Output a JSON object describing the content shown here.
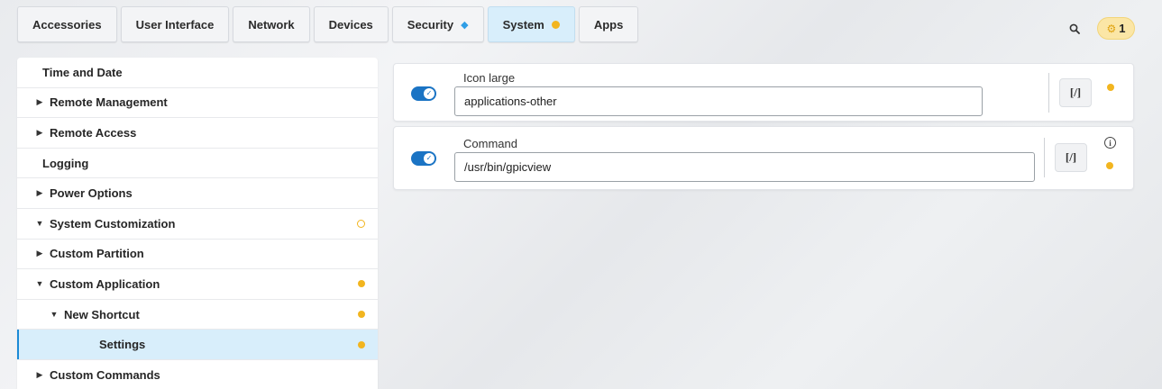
{
  "tabs": [
    {
      "label": "Accessories",
      "marker": ""
    },
    {
      "label": "User Interface",
      "marker": ""
    },
    {
      "label": "Network",
      "marker": ""
    },
    {
      "label": "Devices",
      "marker": ""
    },
    {
      "label": "Security",
      "marker": "diamond"
    },
    {
      "label": "System",
      "marker": "dot",
      "active": true
    },
    {
      "label": "Apps",
      "marker": ""
    }
  ],
  "header": {
    "search_icon": "search-icon",
    "badge_icon": "gear-icon",
    "badge_count": "1"
  },
  "sidebar": {
    "items": [
      {
        "label": "Time and Date",
        "arrow": "",
        "indent": 0,
        "dot": ""
      },
      {
        "label": "Remote Management",
        "arrow": "right",
        "indent": 0,
        "dot": ""
      },
      {
        "label": "Remote Access",
        "arrow": "right",
        "indent": 0,
        "dot": ""
      },
      {
        "label": "Logging",
        "arrow": "",
        "indent": 0,
        "dot": ""
      },
      {
        "label": "Power Options",
        "arrow": "right",
        "indent": 0,
        "dot": ""
      },
      {
        "label": "System Customization",
        "arrow": "down",
        "indent": 0,
        "dot": "hollow"
      },
      {
        "label": "Custom Partition",
        "arrow": "right",
        "indent": 1,
        "dot": ""
      },
      {
        "label": "Custom Application",
        "arrow": "down",
        "indent": 1,
        "dot": "filled"
      },
      {
        "label": "New Shortcut",
        "arrow": "down",
        "indent": 2,
        "dot": "filled"
      },
      {
        "label": "Settings",
        "arrow": "",
        "indent": 3,
        "dot": "filled",
        "selected": true
      },
      {
        "label": "Custom Commands",
        "arrow": "right",
        "indent": 1,
        "dot": ""
      }
    ]
  },
  "settings": {
    "icon_large": {
      "label": "Icon large",
      "value": "applications-other",
      "enabled": true,
      "script_label": "[/]"
    },
    "command": {
      "label": "Command",
      "value": "/usr/bin/gpicview",
      "enabled": true,
      "script_label": "[/]",
      "info": "i"
    }
  },
  "colors": {
    "accent": "#1b74c4",
    "selected_bg": "#d8eefb",
    "modified_dot": "#f2b51f",
    "badge_bg": "#fbe6a6"
  }
}
